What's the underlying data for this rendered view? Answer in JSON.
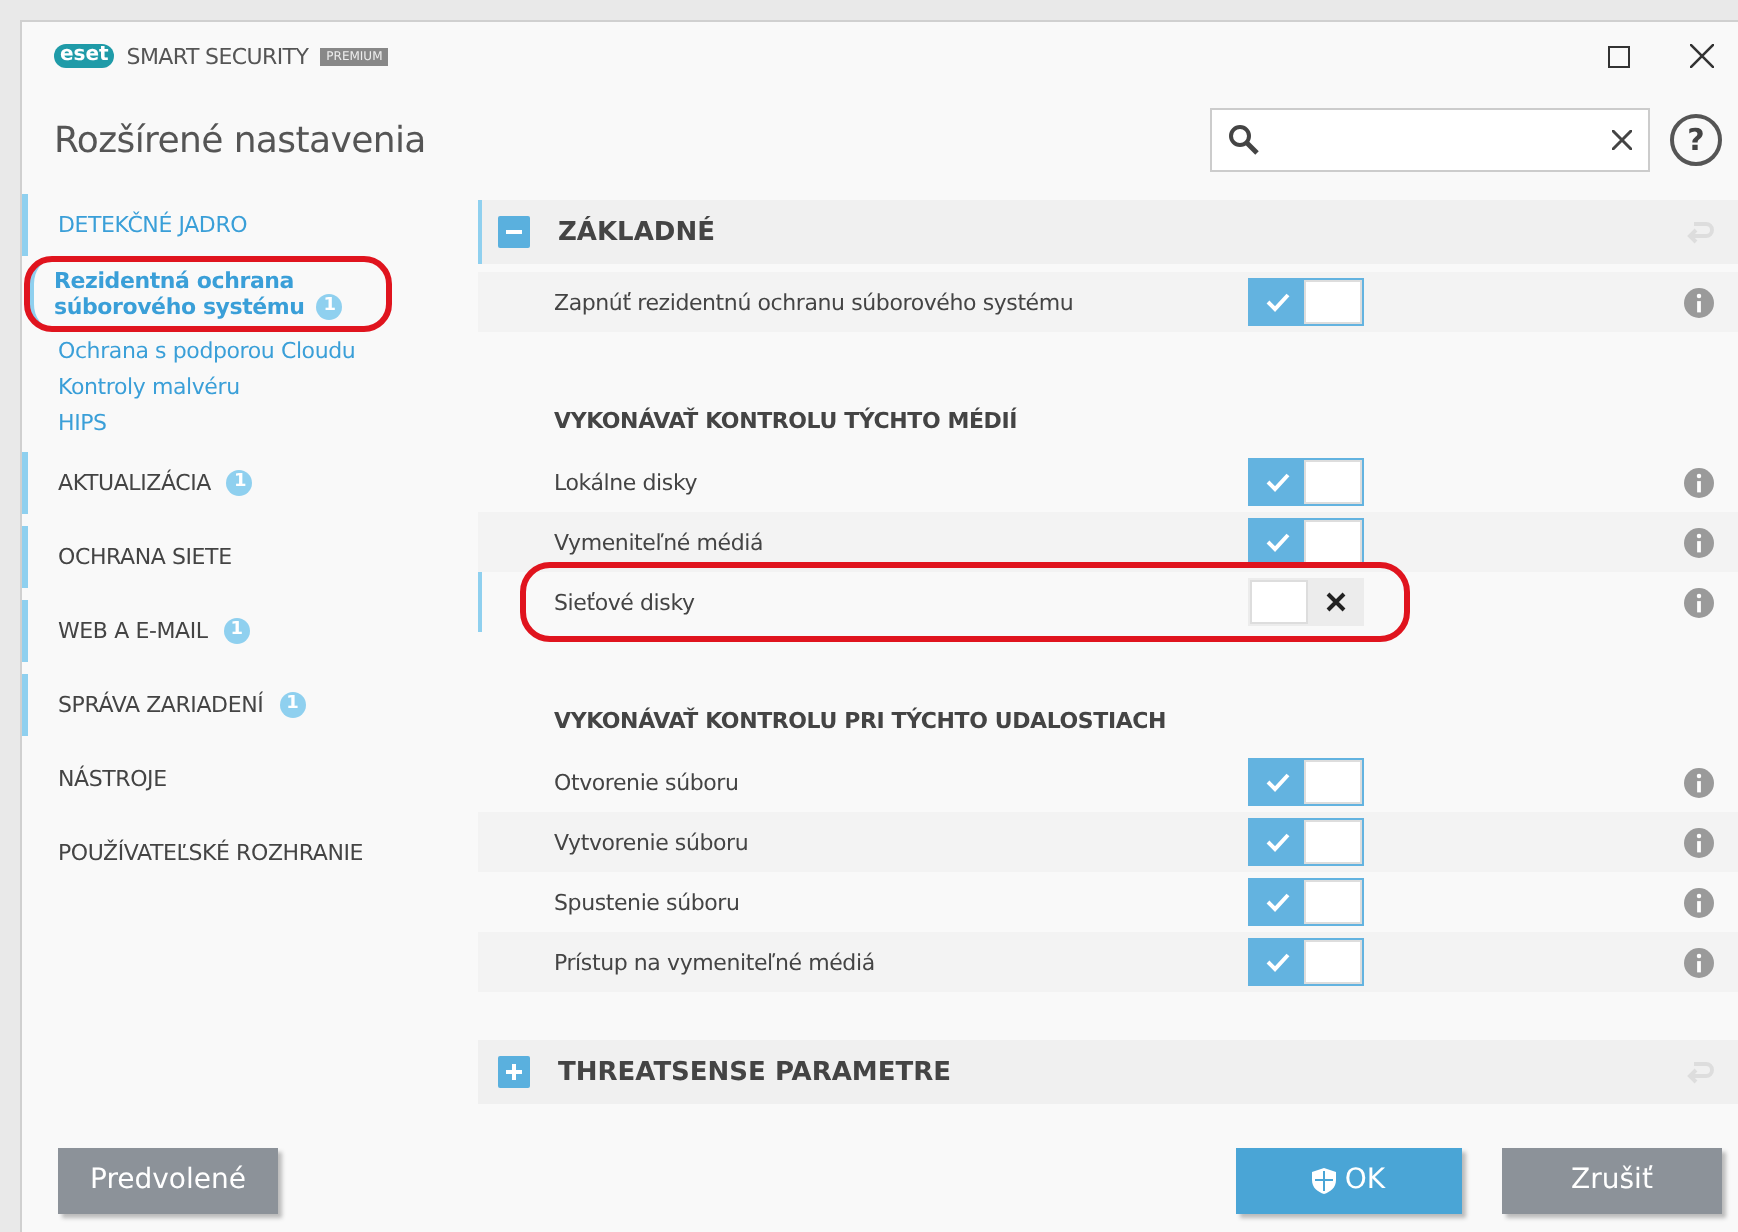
{
  "window": {
    "logo": "eset",
    "product": "SMART SECURITY",
    "edition": "PREMIUM",
    "title": "Rozšírené nastavenia"
  },
  "help": "?",
  "sidebar": {
    "sections": [
      {
        "label": "DETEKČNÉ JADRO",
        "marked": true,
        "expanded": true,
        "children": [
          {
            "label": "Rezidentná ochrana súborového systému",
            "selected": true,
            "highlighted": true,
            "badge": "1"
          },
          {
            "label": "Ochrana s podporou Cloudu",
            "selected": false,
            "highlighted": false
          },
          {
            "label": "Kontroly malvéru",
            "selected": false,
            "highlighted": false
          },
          {
            "label": "HIPS",
            "selected": false,
            "highlighted": false
          }
        ]
      },
      {
        "label": "AKTUALIZÁCIA",
        "marked": true,
        "expanded": false,
        "badge": "1"
      },
      {
        "label": "OCHRANA SIETE",
        "marked": true,
        "expanded": false
      },
      {
        "label": "WEB A E-MAIL",
        "marked": true,
        "expanded": false,
        "badge": "1"
      },
      {
        "label": "SPRÁVA ZARIADENÍ",
        "marked": true,
        "expanded": false,
        "badge": "1"
      },
      {
        "label": "NÁSTROJE",
        "marked": false,
        "expanded": false
      },
      {
        "label": "POUŽÍVATEĽSKÉ ROZHRANIE",
        "marked": false,
        "expanded": false
      }
    ]
  },
  "panels": [
    {
      "title": "ZÁKLADNÉ",
      "expanded": true,
      "groups": [
        {
          "rows": [
            {
              "label": "Zapnúť rezidentnú ochranu súborového systému",
              "on": true,
              "selected": false,
              "highlighted": false
            }
          ]
        },
        {
          "heading": "VYKONÁVAŤ KONTROLU TÝCHTO MÉDIÍ",
          "rows": [
            {
              "label": "Lokálne disky",
              "on": true,
              "selected": false,
              "highlighted": false
            },
            {
              "label": "Vymeniteľné médiá",
              "on": true,
              "selected": false,
              "highlighted": false
            },
            {
              "label": "Sieťové disky",
              "on": false,
              "selected": true,
              "highlighted": true
            }
          ]
        },
        {
          "heading": "VYKONÁVAŤ KONTROLU PRI TÝCHTO UDALOSTIACH",
          "rows": [
            {
              "label": "Otvorenie súboru",
              "on": true,
              "selected": false,
              "highlighted": false
            },
            {
              "label": "Vytvorenie súboru",
              "on": true,
              "selected": false,
              "highlighted": false
            },
            {
              "label": "Spustenie súboru",
              "on": true,
              "selected": false,
              "highlighted": false
            },
            {
              "label": "Prístup na vymeniteľné médiá",
              "on": true,
              "selected": false,
              "highlighted": false
            }
          ]
        }
      ]
    },
    {
      "title": "THREATSENSE PARAMETRE",
      "expanded": false
    }
  ],
  "buttons": [
    {
      "label": "Predvolené",
      "kind": "secondary"
    },
    {
      "label": "OK",
      "kind": "primary"
    },
    {
      "label": "Zrušiť",
      "kind": "secondary"
    }
  ]
}
